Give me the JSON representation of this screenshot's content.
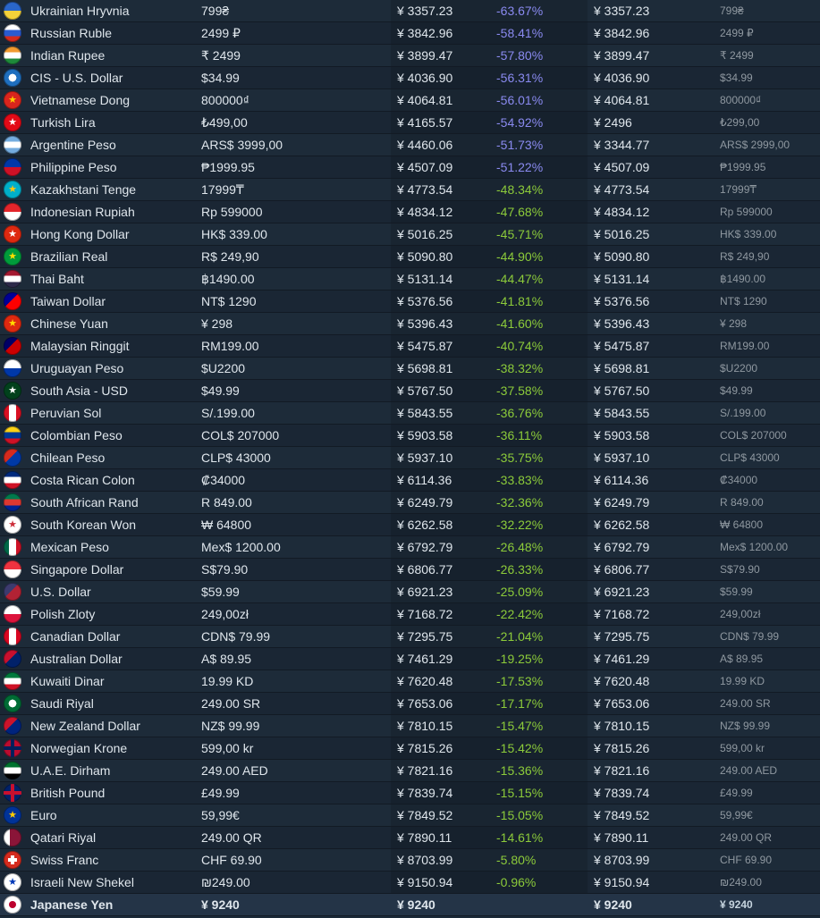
{
  "rows": [
    {
      "name": "Ukrainian Hryvnia",
      "price": "799₴",
      "converted": "¥ 3357.23",
      "diff": "-63.67%",
      "converted2": "¥ 3357.23",
      "original": "799₴",
      "flag": "ua",
      "c1": "#2a66c9",
      "c2": "#f4d23a",
      "style": "h"
    },
    {
      "name": "Russian Ruble",
      "price": "2499 ₽",
      "converted": "¥ 3842.96",
      "diff": "-58.41%",
      "converted2": "¥ 3842.96",
      "original": "2499 ₽",
      "flag": "ru",
      "c1": "#ffffff",
      "c2": "#2a5bd1",
      "c3": "#d52b1e",
      "style": "h3"
    },
    {
      "name": "Indian Rupee",
      "price": "₹ 2499",
      "converted": "¥ 3899.47",
      "diff": "-57.80%",
      "converted2": "¥ 3899.47",
      "original": "₹ 2499",
      "flag": "in",
      "c1": "#f29b31",
      "c2": "#ffffff",
      "c3": "#1e8a3a",
      "style": "h3"
    },
    {
      "name": "CIS - U.S. Dollar",
      "price": "$34.99",
      "converted": "¥ 4036.90",
      "diff": "-56.31%",
      "converted2": "¥ 4036.90",
      "original": "$34.99",
      "flag": "cis",
      "c1": "#1f6fbf",
      "c2": "#ffffff",
      "style": "solid"
    },
    {
      "name": "Vietnamese Dong",
      "price": "800000₫",
      "converted": "¥ 4064.81",
      "diff": "-56.01%",
      "converted2": "¥ 4064.81",
      "original": "800000₫",
      "flag": "vn",
      "c1": "#da251d",
      "c2": "#ffcd00",
      "style": "star"
    },
    {
      "name": "Turkish Lira",
      "price": "₺499,00",
      "converted": "¥ 4165.57",
      "diff": "-54.92%",
      "converted2": "¥ 2496",
      "original": "₺299,00",
      "flag": "tr",
      "c1": "#e30a17",
      "c2": "#ffffff",
      "style": "star"
    },
    {
      "name": "Argentine Peso",
      "price": "ARS$ 3999,00",
      "converted": "¥ 4460.06",
      "diff": "-51.73%",
      "converted2": "¥ 3344.77",
      "original": "ARS$ 2999,00",
      "flag": "ar",
      "c1": "#74acdf",
      "c2": "#ffffff",
      "c3": "#74acdf",
      "style": "h3"
    },
    {
      "name": "Philippine Peso",
      "price": "₱1999.95",
      "converted": "¥ 4507.09",
      "diff": "-51.22%",
      "converted2": "¥ 4507.09",
      "original": "₱1999.95",
      "flag": "ph",
      "c1": "#0038a8",
      "c2": "#ce1126",
      "style": "h"
    },
    {
      "name": "Kazakhstani Tenge",
      "price": "17999₸",
      "converted": "¥ 4773.54",
      "diff": "-48.34%",
      "converted2": "¥ 4773.54",
      "original": "17999₸",
      "flag": "kz",
      "c1": "#00afca",
      "c2": "#fec50c",
      "style": "star"
    },
    {
      "name": "Indonesian Rupiah",
      "price": "Rp 599000",
      "converted": "¥ 4834.12",
      "diff": "-47.68%",
      "converted2": "¥ 4834.12",
      "original": "Rp 599000",
      "flag": "id",
      "c1": "#e4252b",
      "c2": "#ffffff",
      "style": "h"
    },
    {
      "name": "Hong Kong Dollar",
      "price": "HK$ 339.00",
      "converted": "¥ 5016.25",
      "diff": "-45.71%",
      "converted2": "¥ 5016.25",
      "original": "HK$ 339.00",
      "flag": "hk",
      "c1": "#de2910",
      "c2": "#ffffff",
      "style": "star"
    },
    {
      "name": "Brazilian Real",
      "price": "R$ 249,90",
      "converted": "¥ 5090.80",
      "diff": "-44.90%",
      "converted2": "¥ 5090.80",
      "original": "R$ 249,90",
      "flag": "br",
      "c1": "#009c3b",
      "c2": "#ffdf00",
      "style": "star"
    },
    {
      "name": "Thai Baht",
      "price": "฿1490.00",
      "converted": "¥ 5131.14",
      "diff": "-44.47%",
      "converted2": "¥ 5131.14",
      "original": "฿1490.00",
      "flag": "th",
      "c1": "#a51931",
      "c2": "#ffffff",
      "c3": "#2d2a4a",
      "style": "h3"
    },
    {
      "name": "Taiwan Dollar",
      "price": "NT$ 1290",
      "converted": "¥ 5376.56",
      "diff": "-41.81%",
      "converted2": "¥ 5376.56",
      "original": "NT$ 1290",
      "flag": "tw",
      "c1": "#fe0000",
      "c2": "#000095",
      "style": "corner"
    },
    {
      "name": "Chinese Yuan",
      "price": "¥ 298",
      "converted": "¥ 5396.43",
      "diff": "-41.60%",
      "converted2": "¥ 5396.43",
      "original": "¥ 298",
      "flag": "cn",
      "c1": "#de2910",
      "c2": "#ffde00",
      "style": "star"
    },
    {
      "name": "Malaysian Ringgit",
      "price": "RM199.00",
      "converted": "¥ 5475.87",
      "diff": "-40.74%",
      "converted2": "¥ 5475.87",
      "original": "RM199.00",
      "flag": "my",
      "c1": "#cc0001",
      "c2": "#010066",
      "style": "corner"
    },
    {
      "name": "Uruguayan Peso",
      "price": "$U2200",
      "converted": "¥ 5698.81",
      "diff": "-38.32%",
      "converted2": "¥ 5698.81",
      "original": "$U2200",
      "flag": "uy",
      "c1": "#ffffff",
      "c2": "#0038a8",
      "style": "h"
    },
    {
      "name": "South Asia - USD",
      "price": "$49.99",
      "converted": "¥ 5767.50",
      "diff": "-37.58%",
      "converted2": "¥ 5767.50",
      "original": "$49.99",
      "flag": "sa_usd",
      "c1": "#01411c",
      "c2": "#ffffff",
      "style": "star"
    },
    {
      "name": "Peruvian Sol",
      "price": "S/.199.00",
      "converted": "¥ 5843.55",
      "diff": "-36.76%",
      "converted2": "¥ 5843.55",
      "original": "S/.199.00",
      "flag": "pe",
      "c1": "#d91023",
      "c2": "#ffffff",
      "c3": "#d91023",
      "style": "v3"
    },
    {
      "name": "Colombian Peso",
      "price": "COL$ 207000",
      "converted": "¥ 5903.58",
      "diff": "-36.11%",
      "converted2": "¥ 5903.58",
      "original": "COL$ 207000",
      "flag": "co",
      "c1": "#fcd116",
      "c2": "#003893",
      "c3": "#ce1126",
      "style": "h3"
    },
    {
      "name": "Chilean Peso",
      "price": "CLP$ 43000",
      "converted": "¥ 5937.10",
      "diff": "-35.75%",
      "converted2": "¥ 5937.10",
      "original": "CLP$ 43000",
      "flag": "cl",
      "c1": "#0039a6",
      "c2": "#d52b1e",
      "style": "corner"
    },
    {
      "name": "Costa Rican Colon",
      "price": "₡34000",
      "converted": "¥ 6114.36",
      "diff": "-33.83%",
      "converted2": "¥ 6114.36",
      "original": "₡34000",
      "flag": "cr",
      "c1": "#002b7f",
      "c2": "#ffffff",
      "c3": "#ce1126",
      "style": "h3"
    },
    {
      "name": "South African Rand",
      "price": "R 849.00",
      "converted": "¥ 6249.79",
      "diff": "-32.36%",
      "converted2": "¥ 6249.79",
      "original": "R 849.00",
      "flag": "za",
      "c1": "#007a4d",
      "c2": "#de3831",
      "c3": "#002395",
      "style": "h3"
    },
    {
      "name": "South Korean Won",
      "price": "₩ 64800",
      "converted": "¥ 6262.58",
      "diff": "-32.22%",
      "converted2": "¥ 6262.58",
      "original": "₩ 64800",
      "flag": "kr",
      "c1": "#ffffff",
      "c2": "#cd2e3a",
      "style": "star"
    },
    {
      "name": "Mexican Peso",
      "price": "Mex$ 1200.00",
      "converted": "¥ 6792.79",
      "diff": "-26.48%",
      "converted2": "¥ 6792.79",
      "original": "Mex$ 1200.00",
      "flag": "mx",
      "c1": "#006847",
      "c2": "#ffffff",
      "c3": "#ce1126",
      "style": "v3"
    },
    {
      "name": "Singapore Dollar",
      "price": "S$79.90",
      "converted": "¥ 6806.77",
      "diff": "-26.33%",
      "converted2": "¥ 6806.77",
      "original": "S$79.90",
      "flag": "sg",
      "c1": "#ef3340",
      "c2": "#ffffff",
      "style": "h"
    },
    {
      "name": "U.S. Dollar",
      "price": "$59.99",
      "converted": "¥ 6921.23",
      "diff": "-25.09%",
      "converted2": "¥ 6921.23",
      "original": "$59.99",
      "flag": "us",
      "c1": "#b22234",
      "c2": "#3c3b6e",
      "style": "corner"
    },
    {
      "name": "Polish Zloty",
      "price": "249,00zł",
      "converted": "¥ 7168.72",
      "diff": "-22.42%",
      "converted2": "¥ 7168.72",
      "original": "249,00zł",
      "flag": "pl",
      "c1": "#ffffff",
      "c2": "#dc143c",
      "style": "h"
    },
    {
      "name": "Canadian Dollar",
      "price": "CDN$ 79.99",
      "converted": "¥ 7295.75",
      "diff": "-21.04%",
      "converted2": "¥ 7295.75",
      "original": "CDN$ 79.99",
      "flag": "ca",
      "c1": "#d80621",
      "c2": "#ffffff",
      "c3": "#d80621",
      "style": "v3"
    },
    {
      "name": "Australian Dollar",
      "price": "A$ 89.95",
      "converted": "¥ 7461.29",
      "diff": "-19.25%",
      "converted2": "¥ 7461.29",
      "original": "A$ 89.95",
      "flag": "au",
      "c1": "#012169",
      "c2": "#c8102e",
      "style": "corner"
    },
    {
      "name": "Kuwaiti Dinar",
      "price": "19.99 KD",
      "converted": "¥ 7620.48",
      "diff": "-17.53%",
      "converted2": "¥ 7620.48",
      "original": "19.99 KD",
      "flag": "kw",
      "c1": "#007a3d",
      "c2": "#ffffff",
      "c3": "#ce1126",
      "style": "h3"
    },
    {
      "name": "Saudi Riyal",
      "price": "249.00 SR",
      "converted": "¥ 7653.06",
      "diff": "-17.17%",
      "converted2": "¥ 7653.06",
      "original": "249.00 SR",
      "flag": "sa",
      "c1": "#006c35",
      "c2": "#ffffff",
      "style": "solid"
    },
    {
      "name": "New Zealand Dollar",
      "price": "NZ$ 99.99",
      "converted": "¥ 7810.15",
      "diff": "-15.47%",
      "converted2": "¥ 7810.15",
      "original": "NZ$ 99.99",
      "flag": "nz",
      "c1": "#00247d",
      "c2": "#cc142b",
      "style": "corner"
    },
    {
      "name": "Norwegian Krone",
      "price": "599,00 kr",
      "converted": "¥ 7815.26",
      "diff": "-15.42%",
      "converted2": "¥ 7815.26",
      "original": "599,00 kr",
      "flag": "no",
      "c1": "#ba0c2f",
      "c2": "#00205b",
      "style": "cross"
    },
    {
      "name": "U.A.E. Dirham",
      "price": "249.00 AED",
      "converted": "¥ 7821.16",
      "diff": "-15.36%",
      "converted2": "¥ 7821.16",
      "original": "249.00 AED",
      "flag": "ae",
      "c1": "#00732f",
      "c2": "#ffffff",
      "c3": "#000000",
      "style": "h3"
    },
    {
      "name": "British Pound",
      "price": "£49.99",
      "converted": "¥ 7839.74",
      "diff": "-15.15%",
      "converted2": "¥ 7839.74",
      "original": "£49.99",
      "flag": "gb",
      "c1": "#012169",
      "c2": "#c8102e",
      "style": "cross"
    },
    {
      "name": "Euro",
      "price": "59,99€",
      "converted": "¥ 7849.52",
      "diff": "-15.05%",
      "converted2": "¥ 7849.52",
      "original": "59,99€",
      "flag": "eu",
      "c1": "#003399",
      "c2": "#ffcc00",
      "style": "star"
    },
    {
      "name": "Qatari Riyal",
      "price": "249.00 QR",
      "converted": "¥ 7890.11",
      "diff": "-14.61%",
      "converted2": "¥ 7890.11",
      "original": "249.00 QR",
      "flag": "qa",
      "c1": "#ffffff",
      "c2": "#8a1538",
      "style": "v"
    },
    {
      "name": "Swiss Franc",
      "price": "CHF 69.90",
      "converted": "¥ 8703.99",
      "diff": "-5.80%",
      "converted2": "¥ 8703.99",
      "original": "CHF 69.90",
      "flag": "ch",
      "c1": "#d52b1e",
      "c2": "#ffffff",
      "style": "cross2"
    },
    {
      "name": "Israeli New Shekel",
      "price": "₪249.00",
      "converted": "¥ 9150.94",
      "diff": "-0.96%",
      "converted2": "¥ 9150.94",
      "original": "₪249.00",
      "flag": "il",
      "c1": "#ffffff",
      "c2": "#0038b8",
      "style": "star"
    },
    {
      "name": "Japanese Yen",
      "price": "¥ 9240",
      "converted": "¥ 9240",
      "diff": "",
      "converted2": "¥ 9240",
      "original": "¥ 9240",
      "flag": "jp",
      "c1": "#ffffff",
      "c2": "#bc002d",
      "style": "dot",
      "ref": true
    }
  ],
  "colors": {
    "background": "#1b2838",
    "text": "#dfe6ec",
    "muted": "#8f98a0",
    "diff_large_discount": "#8a8af0",
    "diff_discount": "#8ccb3a"
  }
}
